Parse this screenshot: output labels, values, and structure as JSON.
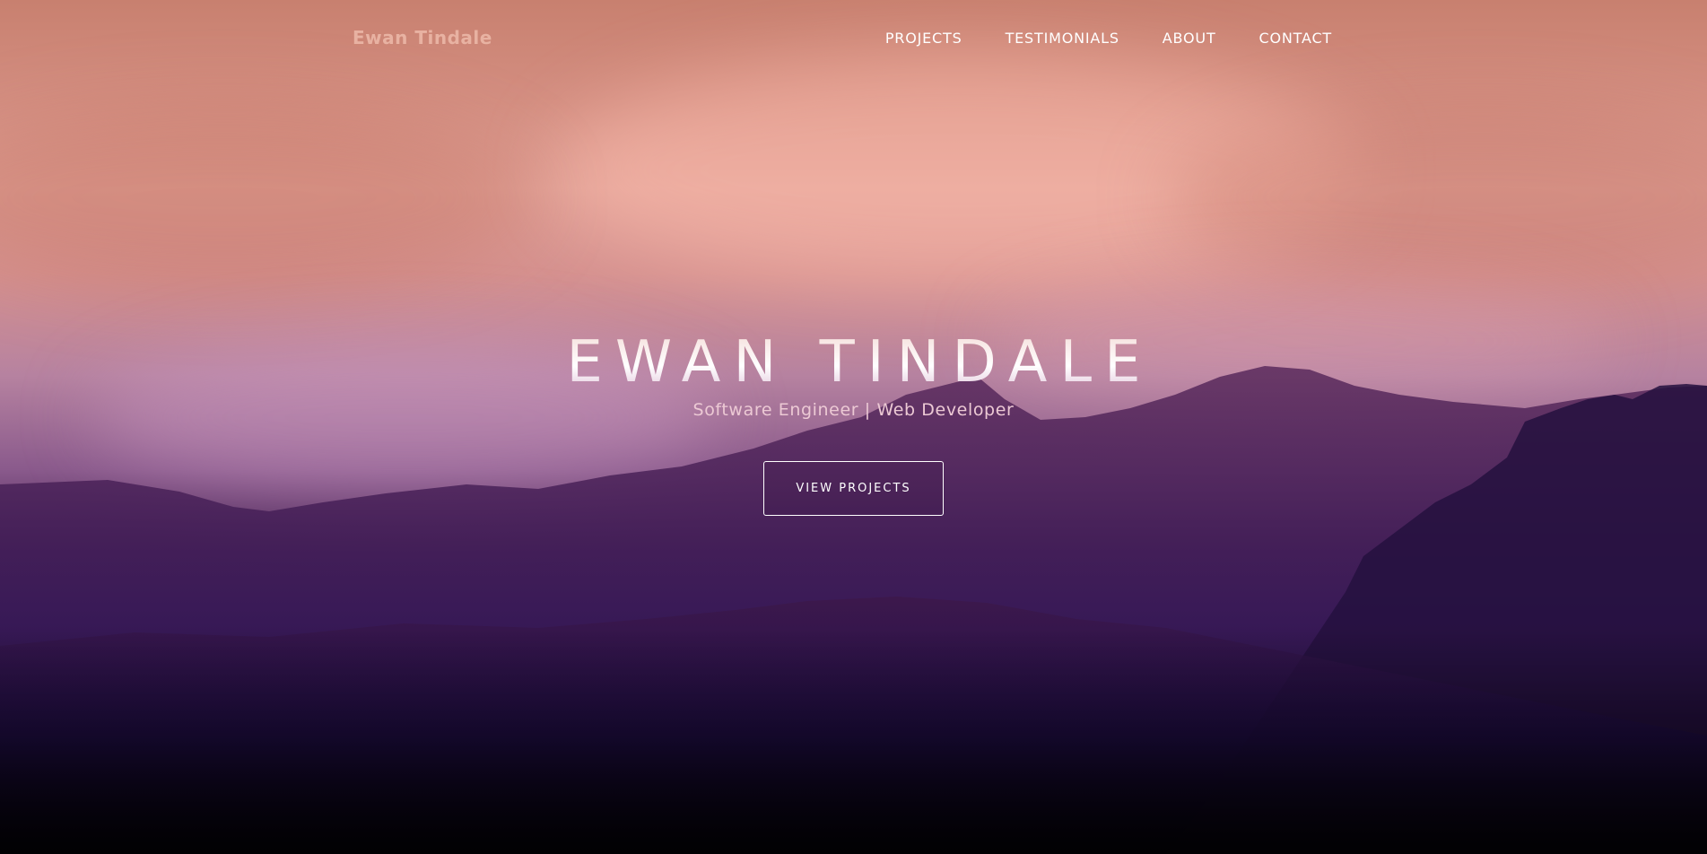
{
  "nav": {
    "brand": "Ewan Tindale",
    "links": [
      {
        "label": "PROJECTS"
      },
      {
        "label": "TESTIMONIALS"
      },
      {
        "label": "ABOUT"
      },
      {
        "label": "CONTACT"
      }
    ]
  },
  "hero": {
    "title": "EWAN TINDALE",
    "subtitle": "Software Engineer | Web Developer",
    "cta_label": "VIEW PROJECTS"
  },
  "colors": {
    "brand_text": "#e8b2a2",
    "sky_top": "#c8806f",
    "sky_pink": "#e0a096",
    "mauve": "#b682a0",
    "deep_purple": "#1c0b4e",
    "bottom": "#050208"
  }
}
